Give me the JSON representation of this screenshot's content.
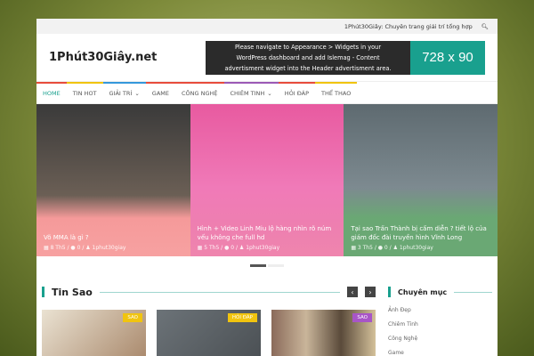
{
  "topbar": {
    "tagline": "1Phút30Giây: Chuyên trang giải trí tổng hợp",
    "search_icon": "search-icon"
  },
  "header": {
    "logo": "1Phút30Giây.net",
    "ad": {
      "line1": "Please navigate to Appearance > Widgets in your",
      "line2": "WordPress dashboard and add Islemag - Content",
      "line3": "advertisment widget into the Header advertisment area.",
      "size": "728 x 90"
    }
  },
  "nav": [
    {
      "label": "HOME",
      "color": "#e74c3c",
      "active": true
    },
    {
      "label": "TIN HOT",
      "color": "#f1c40f"
    },
    {
      "label": "GIẢI TRÍ",
      "color": "#3498db",
      "dropdown": true
    },
    {
      "label": "GAME",
      "color": "#e74c3c"
    },
    {
      "label": "CÔNG NGHỆ",
      "color": "#e74c3c"
    },
    {
      "label": "CHIÊM TINH",
      "color": "#9b59b6",
      "dropdown": true
    },
    {
      "label": "HỎI ĐÁP",
      "color": "#e74c3c"
    },
    {
      "label": "THỂ THAO",
      "color": "#f1c40f"
    }
  ],
  "slides": [
    {
      "title": "Võ MMA là gì ?",
      "date": "8 Th5",
      "comments": "0",
      "author": "1phut30giay"
    },
    {
      "title": "Hình + Video Linh Miu lộ hàng nhìn rõ núm vếu không che full hd",
      "date": "5 Th5",
      "comments": "0",
      "author": "1phut30giay"
    },
    {
      "title": "Tại sao Trấn Thành bị cấm diễn ? tiết lộ của giám đốc đài truyền hình Vĩnh Long",
      "date": "3 Th5",
      "comments": "0",
      "author": "1phut30giay"
    }
  ],
  "section": {
    "title": "Tin Sao",
    "prev": "‹",
    "next": "›",
    "cards": [
      {
        "badge": "SAO",
        "color": "#f1c40f"
      },
      {
        "badge": "HỎI ĐÁP",
        "color": "#f1c40f"
      },
      {
        "badge": "SAO",
        "color": "#a855c7"
      }
    ]
  },
  "sidebar": {
    "title": "Chuyên mục",
    "items": [
      "Ảnh Đẹp",
      "Chiêm Tinh",
      "Công Nghệ",
      "Game"
    ]
  }
}
